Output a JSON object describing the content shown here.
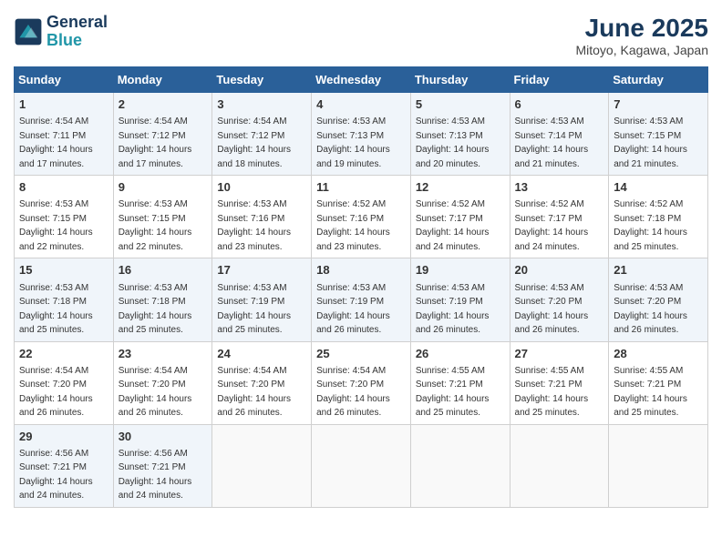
{
  "header": {
    "logo_line1": "General",
    "logo_line2": "Blue",
    "month_title": "June 2025",
    "location": "Mitoyo, Kagawa, Japan"
  },
  "days_of_week": [
    "Sunday",
    "Monday",
    "Tuesday",
    "Wednesday",
    "Thursday",
    "Friday",
    "Saturday"
  ],
  "weeks": [
    [
      {
        "day": "1",
        "sunrise": "4:54 AM",
        "sunset": "7:11 PM",
        "daylight": "14 hours and 17 minutes."
      },
      {
        "day": "2",
        "sunrise": "4:54 AM",
        "sunset": "7:12 PM",
        "daylight": "14 hours and 17 minutes."
      },
      {
        "day": "3",
        "sunrise": "4:54 AM",
        "sunset": "7:12 PM",
        "daylight": "14 hours and 18 minutes."
      },
      {
        "day": "4",
        "sunrise": "4:53 AM",
        "sunset": "7:13 PM",
        "daylight": "14 hours and 19 minutes."
      },
      {
        "day": "5",
        "sunrise": "4:53 AM",
        "sunset": "7:13 PM",
        "daylight": "14 hours and 20 minutes."
      },
      {
        "day": "6",
        "sunrise": "4:53 AM",
        "sunset": "7:14 PM",
        "daylight": "14 hours and 21 minutes."
      },
      {
        "day": "7",
        "sunrise": "4:53 AM",
        "sunset": "7:15 PM",
        "daylight": "14 hours and 21 minutes."
      }
    ],
    [
      {
        "day": "8",
        "sunrise": "4:53 AM",
        "sunset": "7:15 PM",
        "daylight": "14 hours and 22 minutes."
      },
      {
        "day": "9",
        "sunrise": "4:53 AM",
        "sunset": "7:15 PM",
        "daylight": "14 hours and 22 minutes."
      },
      {
        "day": "10",
        "sunrise": "4:53 AM",
        "sunset": "7:16 PM",
        "daylight": "14 hours and 23 minutes."
      },
      {
        "day": "11",
        "sunrise": "4:52 AM",
        "sunset": "7:16 PM",
        "daylight": "14 hours and 23 minutes."
      },
      {
        "day": "12",
        "sunrise": "4:52 AM",
        "sunset": "7:17 PM",
        "daylight": "14 hours and 24 minutes."
      },
      {
        "day": "13",
        "sunrise": "4:52 AM",
        "sunset": "7:17 PM",
        "daylight": "14 hours and 24 minutes."
      },
      {
        "day": "14",
        "sunrise": "4:52 AM",
        "sunset": "7:18 PM",
        "daylight": "14 hours and 25 minutes."
      }
    ],
    [
      {
        "day": "15",
        "sunrise": "4:53 AM",
        "sunset": "7:18 PM",
        "daylight": "14 hours and 25 minutes."
      },
      {
        "day": "16",
        "sunrise": "4:53 AM",
        "sunset": "7:18 PM",
        "daylight": "14 hours and 25 minutes."
      },
      {
        "day": "17",
        "sunrise": "4:53 AM",
        "sunset": "7:19 PM",
        "daylight": "14 hours and 25 minutes."
      },
      {
        "day": "18",
        "sunrise": "4:53 AM",
        "sunset": "7:19 PM",
        "daylight": "14 hours and 26 minutes."
      },
      {
        "day": "19",
        "sunrise": "4:53 AM",
        "sunset": "7:19 PM",
        "daylight": "14 hours and 26 minutes."
      },
      {
        "day": "20",
        "sunrise": "4:53 AM",
        "sunset": "7:20 PM",
        "daylight": "14 hours and 26 minutes."
      },
      {
        "day": "21",
        "sunrise": "4:53 AM",
        "sunset": "7:20 PM",
        "daylight": "14 hours and 26 minutes."
      }
    ],
    [
      {
        "day": "22",
        "sunrise": "4:54 AM",
        "sunset": "7:20 PM",
        "daylight": "14 hours and 26 minutes."
      },
      {
        "day": "23",
        "sunrise": "4:54 AM",
        "sunset": "7:20 PM",
        "daylight": "14 hours and 26 minutes."
      },
      {
        "day": "24",
        "sunrise": "4:54 AM",
        "sunset": "7:20 PM",
        "daylight": "14 hours and 26 minutes."
      },
      {
        "day": "25",
        "sunrise": "4:54 AM",
        "sunset": "7:20 PM",
        "daylight": "14 hours and 26 minutes."
      },
      {
        "day": "26",
        "sunrise": "4:55 AM",
        "sunset": "7:21 PM",
        "daylight": "14 hours and 25 minutes."
      },
      {
        "day": "27",
        "sunrise": "4:55 AM",
        "sunset": "7:21 PM",
        "daylight": "14 hours and 25 minutes."
      },
      {
        "day": "28",
        "sunrise": "4:55 AM",
        "sunset": "7:21 PM",
        "daylight": "14 hours and 25 minutes."
      }
    ],
    [
      {
        "day": "29",
        "sunrise": "4:56 AM",
        "sunset": "7:21 PM",
        "daylight": "14 hours and 24 minutes."
      },
      {
        "day": "30",
        "sunrise": "4:56 AM",
        "sunset": "7:21 PM",
        "daylight": "14 hours and 24 minutes."
      },
      null,
      null,
      null,
      null,
      null
    ]
  ]
}
